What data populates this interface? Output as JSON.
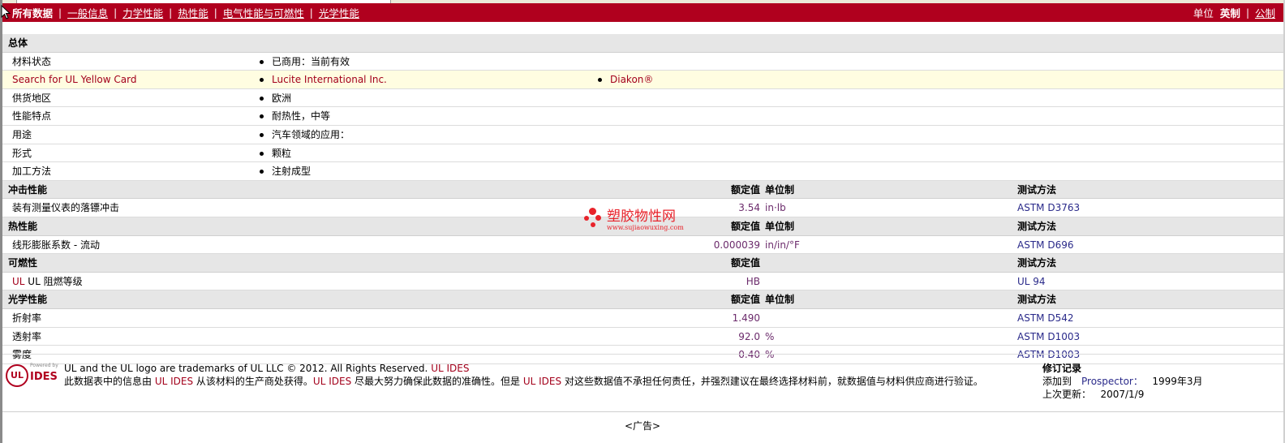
{
  "nav": {
    "items": [
      {
        "label": "所有数据",
        "active": true
      },
      {
        "label": "一般信息"
      },
      {
        "label": "力学性能"
      },
      {
        "label": "热性能"
      },
      {
        "label": "电气性能与可燃性"
      },
      {
        "label": "光学性能"
      }
    ],
    "units_label": "单位",
    "imperial": "英制",
    "metric": "公制"
  },
  "general": {
    "title": "总体",
    "rows": [
      {
        "label": "材料状态",
        "values": [
          "已商用：当前有效"
        ]
      },
      {
        "label": "Search for UL Yellow Card",
        "values": [
          "Lucite International Inc.",
          "Diakon®"
        ]
      },
      {
        "label": "供货地区",
        "values": [
          "欧洲"
        ]
      },
      {
        "label": "性能特点",
        "values": [
          "耐热性，中等"
        ]
      },
      {
        "label": "用途",
        "values": [
          "汽车领域的应用："
        ]
      },
      {
        "label": "形式",
        "values": [
          "颗粒"
        ]
      },
      {
        "label": "加工方法",
        "values": [
          "注射成型"
        ]
      }
    ]
  },
  "col_headers": {
    "value": "额定值",
    "unit": "单位制",
    "test": "测试方法"
  },
  "sections": [
    {
      "title": "冲击性能",
      "rows": [
        {
          "label": "装有测量仪表的落镖冲击",
          "value": "3.54",
          "unit": "in·lb",
          "test": "ASTM D3763"
        }
      ]
    },
    {
      "title": "热性能",
      "rows": [
        {
          "label": "线形膨胀系数  - 流动",
          "value": "0.000039",
          "unit": "in/in/°F",
          "test": "ASTM D696"
        }
      ]
    },
    {
      "title": "可燃性",
      "rows": [
        {
          "label": "UL 阻燃等级",
          "value": "HB",
          "unit": "",
          "test": "UL 94"
        }
      ]
    },
    {
      "title": "光学性能",
      "rows": [
        {
          "label": "折射率",
          "value": "1.490",
          "unit": "",
          "test": "ASTM D542"
        },
        {
          "label": "透射率",
          "value": "92.0",
          "unit": "%",
          "test": "ASTM D1003"
        },
        {
          "label": "雾度",
          "value": "0.40",
          "unit": "%",
          "test": "ASTM D1003"
        }
      ]
    }
  ],
  "watermark": {
    "cn": "塑胶物性网",
    "url": "www.sujiaowuxing.com"
  },
  "footer": {
    "logo_powered": "Powered by",
    "logo_ul": "UL",
    "logo_ides": "IDES",
    "trademark": "UL and the UL logo are trademarks of UL LLC © 2012. All Rights Reserved.",
    "ul_ides": "UL IDES",
    "disclaimer_a": "此数据表中的信息由 ",
    "disclaimer_b": " 从该材料的生产商处获得。",
    "disclaimer_c": " 尽最大努力确保此数据的准确性。但是 ",
    "disclaimer_d": " 对这些数据值不承担任何责任，并强烈建议在最终选择材料前，就数据值与材料供应商进行验证。",
    "revision_title": "修订记录",
    "added_label": "添加到",
    "added_to": "Prospector：",
    "added_date": "1999年3月",
    "updated_label": "上次更新：",
    "updated_date": "2007/1/9"
  },
  "ad_label": "<广告>"
}
